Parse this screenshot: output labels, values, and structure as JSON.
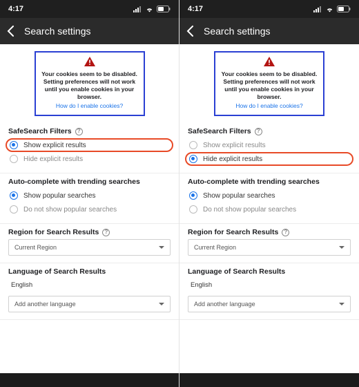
{
  "statusbar": {
    "time": "4:17"
  },
  "header": {
    "title": "Search settings"
  },
  "warn": {
    "line1": "Your cookies seem to be disabled.",
    "line2": "Setting preferences will not work until you enable cookies in your browser.",
    "link": "How do I enable cookies?"
  },
  "left": {
    "safesearch": {
      "title": "SafeSearch Filters",
      "options": [
        "Show explicit results",
        "Hide explicit results"
      ],
      "selected": 0,
      "highlighted": 0
    },
    "autocomplete": {
      "title": "Auto-complete with trending searches",
      "options": [
        "Show popular searches",
        "Do not show popular searches"
      ],
      "selected": 0
    },
    "region": {
      "title": "Region for Search Results",
      "value": "Current Region"
    },
    "language": {
      "title": "Language of Search Results",
      "current": "English",
      "add": "Add another language"
    }
  },
  "right": {
    "safesearch": {
      "title": "SafeSearch Filters",
      "options": [
        "Show explicit results",
        "Hide explicit results"
      ],
      "selected": 1,
      "highlighted": 1
    },
    "autocomplete": {
      "title": "Auto-complete with trending searches",
      "options": [
        "Show popular searches",
        "Do not show popular searches"
      ],
      "selected": 0
    },
    "region": {
      "title": "Region for Search Results",
      "value": "Current Region"
    },
    "language": {
      "title": "Language of Search Results",
      "current": "English",
      "add": "Add another language"
    }
  }
}
